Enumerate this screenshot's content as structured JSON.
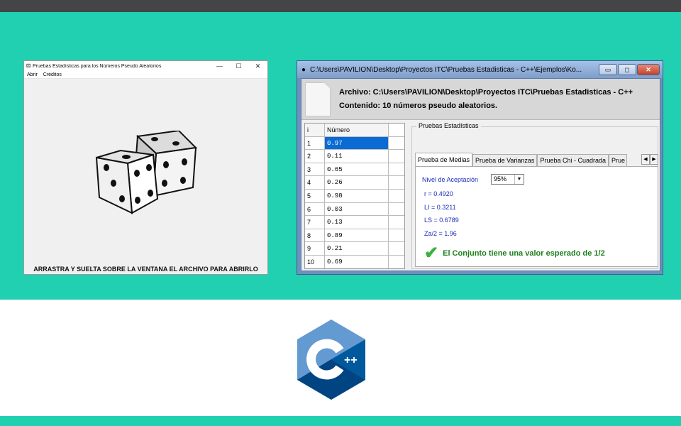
{
  "colors": {
    "teal": "#21cfb1",
    "topbar": "#444546",
    "select": "#0a6bd4",
    "stat_text": "#1a2bb8",
    "success": "#1b7f1b"
  },
  "left_window": {
    "title": "Pruebas Estadísticas para los Números Pseudo Aleatorios",
    "icon": "dice-app-icon",
    "controls": {
      "minimize": "—",
      "maximize": "☐",
      "close": "✕"
    },
    "menu": [
      "Abrir",
      "Créditos"
    ],
    "drop_hint": "ARRASTRA Y SUELTA SOBRE LA VENTANA EL ARCHIVO PARA ABRIRLO"
  },
  "right_window": {
    "title": "C:\\Users\\PAVILION\\Desktop\\Proyectos ITC\\Pruebas Estadisticas - C++\\Ejemplos\\Ko...",
    "controls": {
      "minimize": "▭",
      "maximize": "◻",
      "close": "✕"
    },
    "archivo": "Archivo: C:\\Users\\PAVILION\\Desktop\\Proyectos ITC\\Pruebas Estadisticas - C++",
    "contenido": "Contenido: 10 números pseudo aleatorios.",
    "grid": {
      "headers": [
        "i",
        "Número"
      ],
      "rows": [
        [
          "1",
          "0.97"
        ],
        [
          "2",
          "0.11"
        ],
        [
          "3",
          "0.65"
        ],
        [
          "4",
          "0.26"
        ],
        [
          "5",
          "0.98"
        ],
        [
          "6",
          "0.03"
        ],
        [
          "7",
          "0.13"
        ],
        [
          "8",
          "0.89"
        ],
        [
          "9",
          "0.21"
        ],
        [
          "10",
          "0.69"
        ]
      ],
      "selected_row": 0
    },
    "group_title": "Pruebas Estadísticas",
    "tabs": [
      "Prueba de Medias",
      "Prueba de Varianzas",
      "Prueba Chi - Cuadrada",
      "Prue"
    ],
    "active_tab": 0,
    "tab_scroll": {
      "left": "◀",
      "right": "▶"
    },
    "panel": {
      "acceptance_label": "Nivel de Aceptación",
      "acceptance_value": "95%",
      "combo_arrow": "▼",
      "stats": [
        "r = 0.4920",
        "LI = 0.3211",
        "LS = 0.6789",
        "Za/2 = 1.96"
      ],
      "result_icon": "checkmark-icon",
      "result_text": "El Conjunto tiene una valor esperado de 1/2"
    }
  },
  "logo": {
    "name": "cpp-logo",
    "text": "C++"
  }
}
